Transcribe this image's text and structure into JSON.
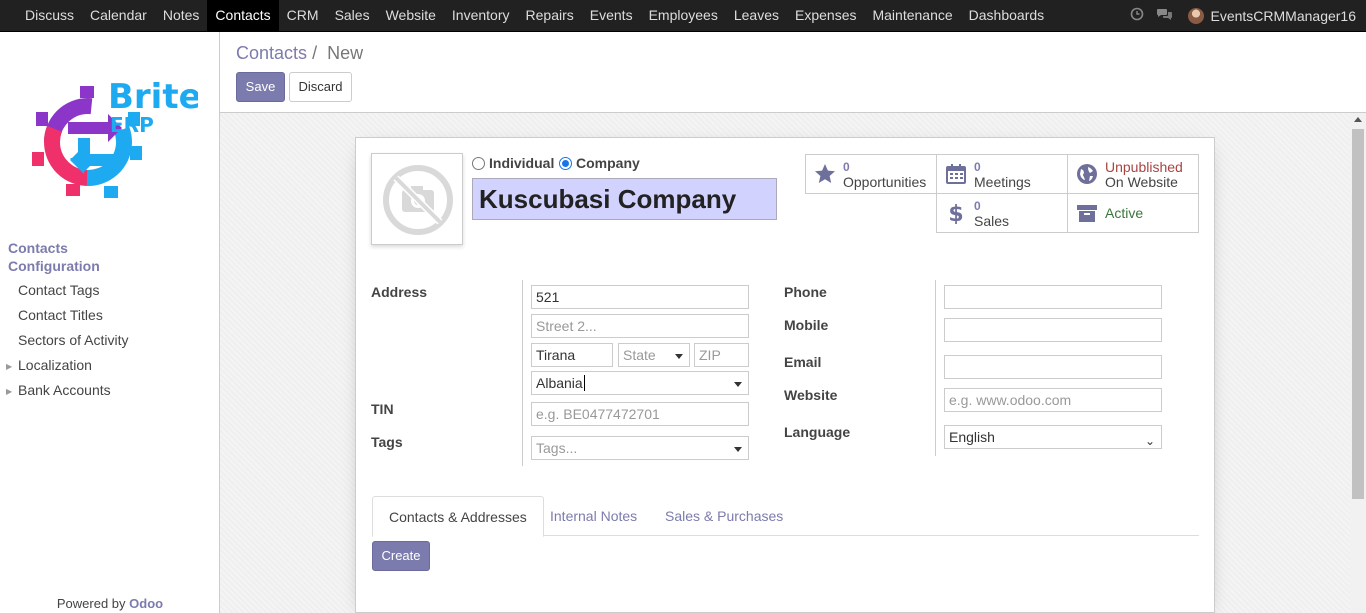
{
  "topnav": {
    "menu": [
      "Discuss",
      "Calendar",
      "Notes",
      "Contacts",
      "CRM",
      "Sales",
      "Website",
      "Inventory",
      "Repairs",
      "Events",
      "Employees",
      "Leaves",
      "Expenses",
      "Maintenance",
      "Dashboards"
    ],
    "active": "Contacts",
    "user": "EventsCRMManager16"
  },
  "sidebar": {
    "logo_text_1": "Brite",
    "logo_text_2": "ERP",
    "sections": [
      "Contacts",
      "Configuration"
    ],
    "items": [
      {
        "label": "Contact Tags",
        "caret": false
      },
      {
        "label": "Contact Titles",
        "caret": false
      },
      {
        "label": "Sectors of Activity",
        "caret": false
      },
      {
        "label": "Localization",
        "caret": true
      },
      {
        "label": "Bank Accounts",
        "caret": true
      }
    ],
    "powered_by": "Powered by",
    "powered_brand": "Odoo"
  },
  "control": {
    "breadcrumb_parent": "Contacts",
    "breadcrumb_sep": "/",
    "breadcrumb_current": "New",
    "save_label": "Save",
    "discard_label": "Discard"
  },
  "form": {
    "type_individual": "Individual",
    "type_company": "Company",
    "company_type_selected": "Company",
    "name": "Kuscubasi Company",
    "stats": {
      "opportunities_count": "0",
      "opportunities_label": "Opportunities",
      "meetings_count": "0",
      "meetings_label": "Meetings",
      "website_line1": "Unpublished",
      "website_line2": "On Website",
      "sales_count": "0",
      "sales_label": "Sales",
      "active_label": "Active"
    },
    "labels": {
      "address": "Address",
      "tin": "TIN",
      "tags": "Tags",
      "phone": "Phone",
      "mobile": "Mobile",
      "email": "Email",
      "website": "Website",
      "language": "Language"
    },
    "values": {
      "street": "521",
      "street2_placeholder": "Street 2...",
      "city": "Tirana",
      "state_placeholder": "State",
      "zip_placeholder": "ZIP",
      "country": "Albania",
      "tin_placeholder": "e.g. BE0477472701",
      "tags_placeholder": "Tags...",
      "phone": "",
      "mobile": "",
      "email": "",
      "website_placeholder": "e.g. www.odoo.com",
      "language": "English"
    },
    "tabs": [
      "Contacts & Addresses",
      "Internal Notes",
      "Sales & Purchases"
    ],
    "create_label": "Create"
  },
  "colors": {
    "accent": "#7c7bad",
    "topbar": "#212121",
    "name_field": "#d2d2ff",
    "unpublished": "#a94442",
    "logo_purple": "#8c35c9",
    "logo_pink": "#f0306a",
    "logo_cyan": "#1eaaf1"
  }
}
